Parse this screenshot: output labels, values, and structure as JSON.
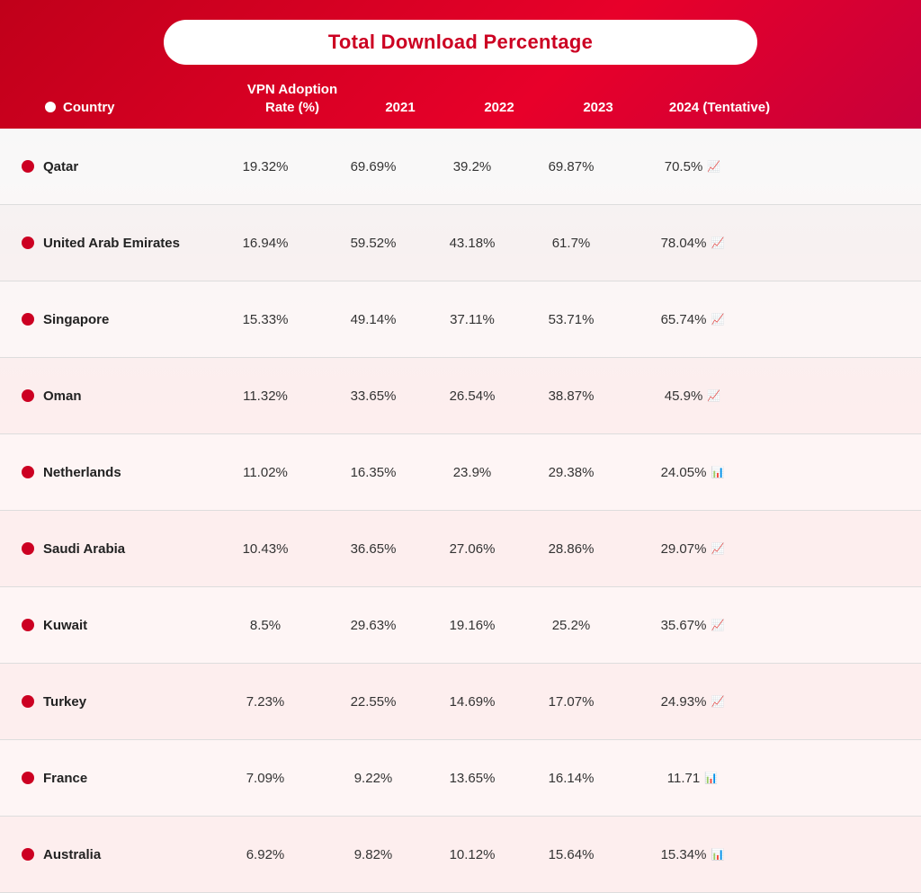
{
  "title": "Total Download Percentage",
  "columns": {
    "country": "Country",
    "vpn_adoption": "VPN Adoption Rate (%)",
    "year_2021": "2021",
    "year_2022": "2022",
    "year_2023": "2023",
    "year_2024": "2024 (Tentative)"
  },
  "rows": [
    {
      "country": "Qatar",
      "vpn_adoption": "19.32%",
      "y2021": "69.69%",
      "y2022": "39.2%",
      "y2023": "69.87%",
      "y2024": "70.5%",
      "trend": "up"
    },
    {
      "country": "United Arab Emirates",
      "vpn_adoption": "16.94%",
      "y2021": "59.52%",
      "y2022": "43.18%",
      "y2023": "61.7%",
      "y2024": "78.04%",
      "trend": "up"
    },
    {
      "country": "Singapore",
      "vpn_adoption": "15.33%",
      "y2021": "49.14%",
      "y2022": "37.11%",
      "y2023": "53.71%",
      "y2024": "65.74%",
      "trend": "up"
    },
    {
      "country": "Oman",
      "vpn_adoption": "11.32%",
      "y2021": "33.65%",
      "y2022": "26.54%",
      "y2023": "38.87%",
      "y2024": "45.9%",
      "trend": "up"
    },
    {
      "country": "Netherlands",
      "vpn_adoption": "11.02%",
      "y2021": "16.35%",
      "y2022": "23.9%",
      "y2023": "29.38%",
      "y2024": "24.05%",
      "trend": "flat"
    },
    {
      "country": "Saudi Arabia",
      "vpn_adoption": "10.43%",
      "y2021": "36.65%",
      "y2022": "27.06%",
      "y2023": "28.86%",
      "y2024": "29.07%",
      "trend": "up"
    },
    {
      "country": "Kuwait",
      "vpn_adoption": "8.5%",
      "y2021": "29.63%",
      "y2022": "19.16%",
      "y2023": "25.2%",
      "y2024": "35.67%",
      "trend": "up"
    },
    {
      "country": "Turkey",
      "vpn_adoption": "7.23%",
      "y2021": "22.55%",
      "y2022": "14.69%",
      "y2023": "17.07%",
      "y2024": "24.93%",
      "trend": "up"
    },
    {
      "country": "France",
      "vpn_adoption": "7.09%",
      "y2021": "9.22%",
      "y2022": "13.65%",
      "y2023": "16.14%",
      "y2024": "11.71",
      "trend": "flat"
    },
    {
      "country": "Australia",
      "vpn_adoption": "6.92%",
      "y2021": "9.82%",
      "y2022": "10.12%",
      "y2023": "15.64%",
      "y2024": "15.34%",
      "trend": "flat"
    }
  ]
}
